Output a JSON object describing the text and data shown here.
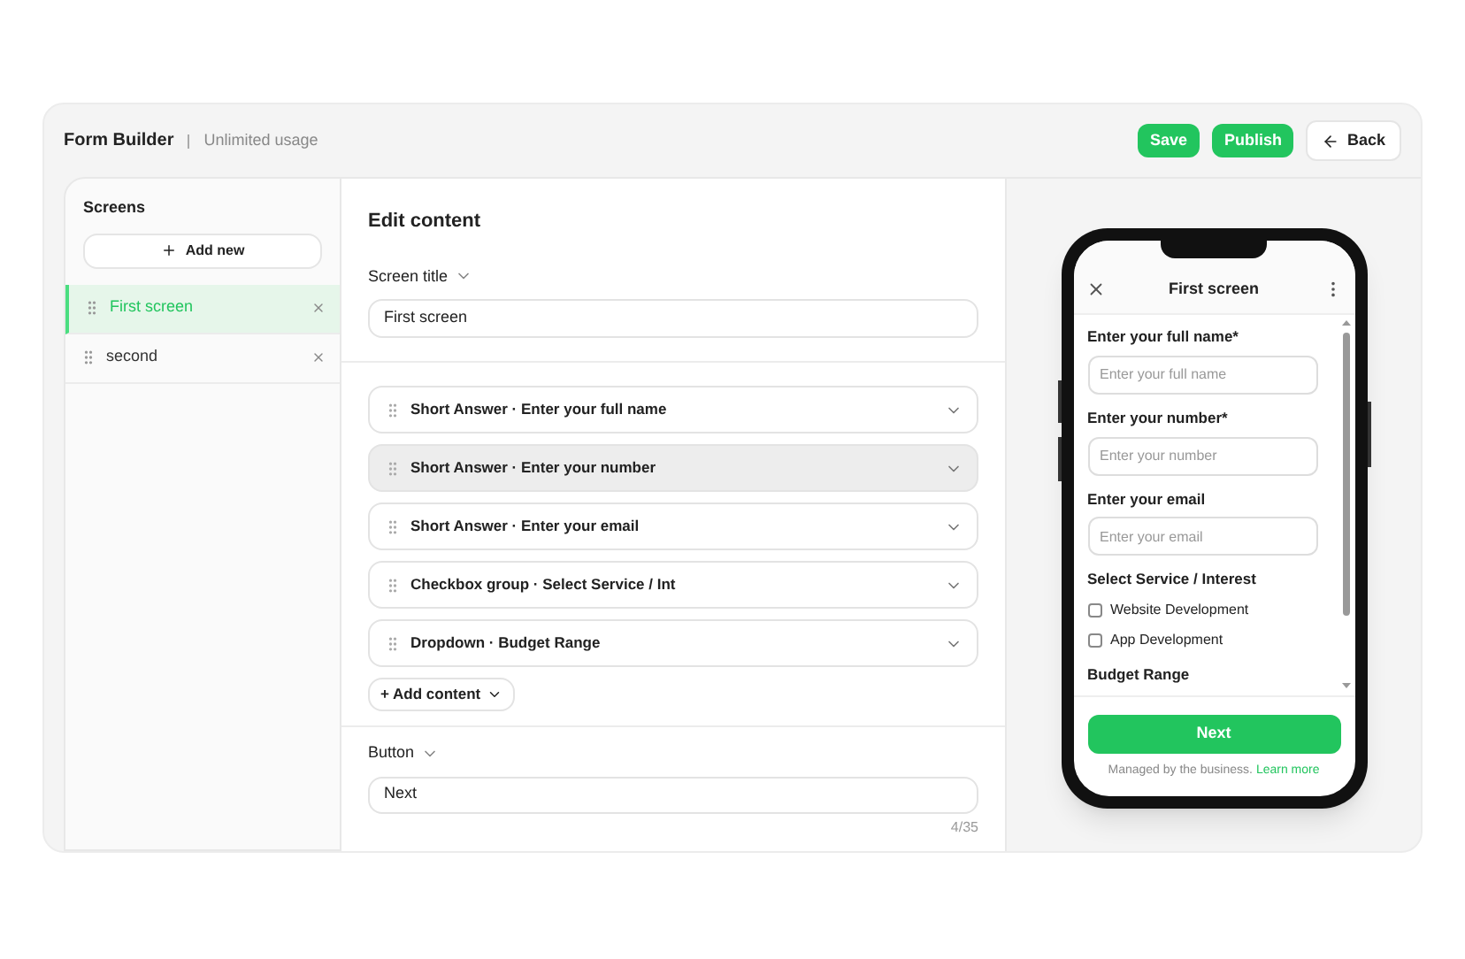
{
  "header": {
    "title": "Form Builder",
    "subtitle": "Unlimited usage",
    "actions": [
      {
        "label": "Save",
        "kind": "primary"
      },
      {
        "label": "Publish",
        "kind": "primary"
      },
      {
        "label": "Back",
        "kind": "back"
      }
    ]
  },
  "sidebar": {
    "title": "Screens",
    "add_button": "Add new",
    "items": [
      {
        "label": "First screen",
        "selected": true
      },
      {
        "label": "second",
        "selected": false
      }
    ]
  },
  "editor": {
    "title": "Edit content",
    "screen_title": {
      "label": "Screen title",
      "value": "First screen"
    },
    "content_items": [
      {
        "label": "Short Answer · Enter your full name",
        "highlighted": false
      },
      {
        "label": "Short Answer · Enter your number",
        "highlighted": true
      },
      {
        "label": "Short Answer · Enter your email",
        "highlighted": false
      },
      {
        "label": "Checkbox group · Select Service / Int",
        "highlighted": false
      },
      {
        "label": "Dropdown · Budget Range",
        "highlighted": false
      }
    ],
    "add_content": "+ Add content",
    "button_section": {
      "label": "Button",
      "value": "Next",
      "counter": "4/35"
    }
  },
  "preview": {
    "title": "First screen",
    "fields": [
      {
        "kind": "text",
        "label": "Enter your full name*",
        "placeholder": "Enter your full name"
      },
      {
        "kind": "text",
        "label": "Enter your number*",
        "placeholder": "Enter your number"
      },
      {
        "kind": "text",
        "label": "Enter your email",
        "placeholder": "Enter your email"
      },
      {
        "kind": "checkbox_group",
        "label": "Select Service / Interest",
        "options": [
          {
            "label": "Website Development",
            "checked": false
          },
          {
            "label": "App Development",
            "checked": false
          }
        ]
      },
      {
        "kind": "dropdown",
        "label": "Budget Range"
      }
    ],
    "button": "Next",
    "footer": "Managed by the business.",
    "footer_link": "Learn more"
  }
}
